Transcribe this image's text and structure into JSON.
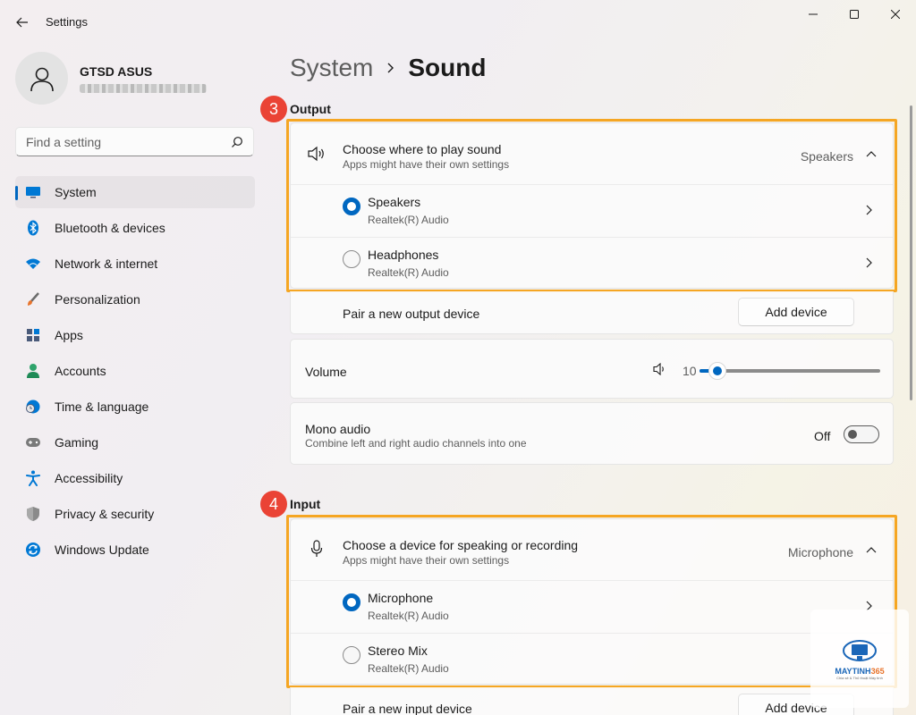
{
  "window": {
    "title": "Settings"
  },
  "profile": {
    "name": "GTSD ASUS"
  },
  "search": {
    "placeholder": "Find a setting"
  },
  "sidebar": {
    "items": [
      {
        "label": "System",
        "icon": "monitor-icon",
        "color": "#0078d4"
      },
      {
        "label": "Bluetooth & devices",
        "icon": "bluetooth-icon",
        "color": "#0078d4"
      },
      {
        "label": "Network & internet",
        "icon": "wifi-icon",
        "color": "#0078d4"
      },
      {
        "label": "Personalization",
        "icon": "brush-icon",
        "color": "#e8742c"
      },
      {
        "label": "Apps",
        "icon": "apps-icon",
        "color": "#4a5a7a"
      },
      {
        "label": "Accounts",
        "icon": "person-icon",
        "color": "#2fa36b"
      },
      {
        "label": "Time & language",
        "icon": "globe-clock-icon",
        "color": "#0078d4"
      },
      {
        "label": "Gaming",
        "icon": "gamepad-icon",
        "color": "#6b6b6b"
      },
      {
        "label": "Accessibility",
        "icon": "accessibility-icon",
        "color": "#0078d4"
      },
      {
        "label": "Privacy & security",
        "icon": "shield-icon",
        "color": "#7a7a7a"
      },
      {
        "label": "Windows Update",
        "icon": "update-icon",
        "color": "#0078d4"
      }
    ],
    "active_index": 0
  },
  "breadcrumb": {
    "parent": "System",
    "current": "Sound"
  },
  "output": {
    "step": "3",
    "label": "Output",
    "choose": {
      "title": "Choose where to play sound",
      "subtitle": "Apps might have their own settings",
      "value": "Speakers"
    },
    "devices": [
      {
        "name": "Speakers",
        "sub": "Realtek(R) Audio",
        "selected": true
      },
      {
        "name": "Headphones",
        "sub": "Realtek(R) Audio",
        "selected": false
      }
    ],
    "pair": {
      "label": "Pair a new output device",
      "button": "Add device"
    },
    "volume": {
      "label": "Volume",
      "value": "10",
      "level": 0.1
    },
    "mono": {
      "title": "Mono audio",
      "subtitle": "Combine left and right audio channels into one",
      "state": "Off"
    }
  },
  "input": {
    "step": "4",
    "label": "Input",
    "choose": {
      "title": "Choose a device for speaking or recording",
      "subtitle": "Apps might have their own settings",
      "value": "Microphone"
    },
    "devices": [
      {
        "name": "Microphone",
        "sub": "Realtek(R) Audio",
        "selected": true
      },
      {
        "name": "Stereo Mix",
        "sub": "Realtek(R) Audio",
        "selected": false
      }
    ],
    "pair": {
      "label": "Pair a new input device",
      "button": "Add device"
    }
  },
  "watermark": {
    "brand_main": "MAYTINH",
    "brand_accent": "365",
    "tagline": "Chia sẻ & Thủ thuật Máy tính"
  },
  "colors": {
    "accent": "#0067c0",
    "highlight": "#f5a623",
    "badge": "#ea4335"
  }
}
